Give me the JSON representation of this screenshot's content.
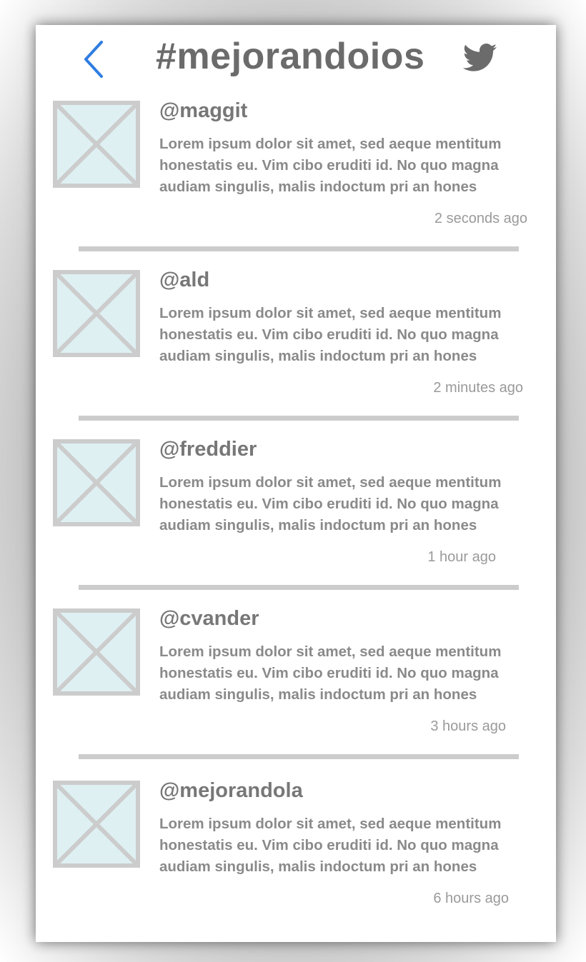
{
  "header": {
    "title": "#mejorandoios",
    "back_icon": "chevron-left-icon",
    "brand_icon": "twitter-bird-icon"
  },
  "colors": {
    "accent": "#2f7de1",
    "avatar_fill": "#dff0f3",
    "avatar_stroke": "#cccccc",
    "divider": "#cccccc"
  },
  "tweets": [
    {
      "handle": "@maggit",
      "text": "Lorem ipsum dolor sit amet, sed aeque mentitum honestatis eu. Vim cibo eruditi id. No quo magna audiam singulis, malis indoctum pri an hones",
      "time": "2 seconds ago"
    },
    {
      "handle": "@ald",
      "text": "Lorem ipsum dolor sit amet, sed aeque mentitum honestatis eu. Vim cibo eruditi id. No quo magna audiam singulis, malis indoctum pri an hones",
      "time": "2 minutes ago"
    },
    {
      "handle": "@freddier",
      "text": "Lorem ipsum dolor sit amet, sed aeque mentitum honestatis eu. Vim cibo eruditi id. No quo magna audiam singulis, malis indoctum pri an hones",
      "time": "1 hour ago"
    },
    {
      "handle": "@cvander",
      "text": "Lorem ipsum dolor sit amet, sed aeque mentitum honestatis eu. Vim cibo eruditi id. No quo magna audiam singulis, malis indoctum pri an hones",
      "time": "3 hours ago"
    },
    {
      "handle": "@mejorandola",
      "text": "Lorem ipsum dolor sit amet, sed aeque mentitum honestatis eu. Vim cibo eruditi id. No quo magna audiam singulis, malis indoctum pri an hones",
      "time": "6 hours ago"
    }
  ]
}
